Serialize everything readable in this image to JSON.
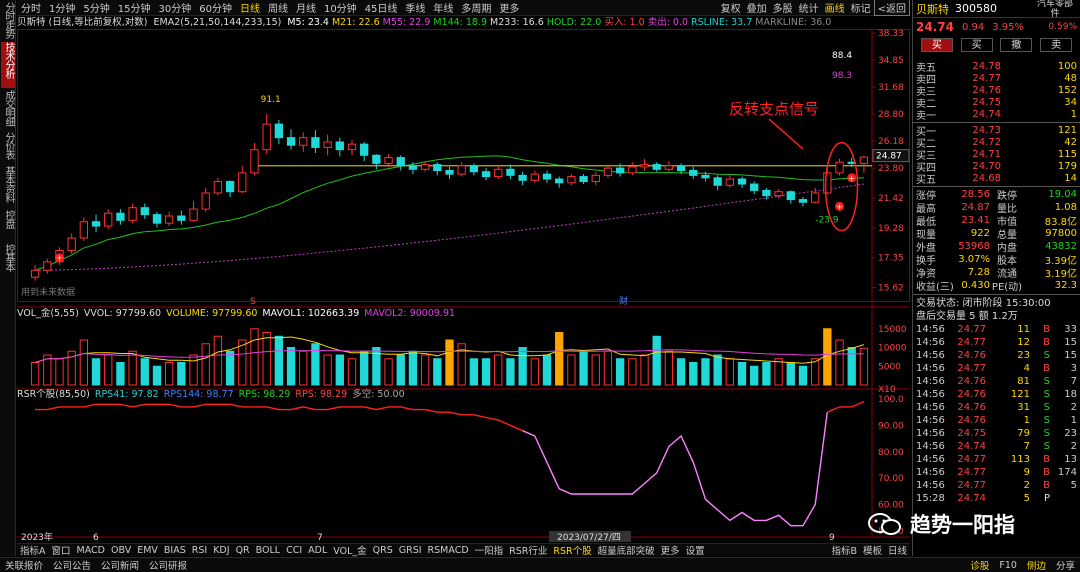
{
  "left_tabs": [
    "分时走势",
    "技术分析",
    "成交明细",
    "分价表",
    "基本资料",
    "控盘",
    "控基本"
  ],
  "periods": [
    "分时",
    "1分钟",
    "5分钟",
    "15分钟",
    "30分钟",
    "60分钟",
    "日线",
    "周线",
    "月线",
    "10分钟",
    "45日线",
    "季线",
    "年线",
    "多周期",
    "更多"
  ],
  "active_period": "日线",
  "tools": [
    "复权",
    "叠加",
    "多股",
    "统计",
    "画线",
    "标记",
    "<返回"
  ],
  "stock_header": {
    "name": "贝斯特",
    "info": "(日线,等比前复权,对数)"
  },
  "ema_label": "EMA2(5,21,50,144,233,15)",
  "ma_values": [
    {
      "text": "M5: 23.4",
      "color": "#ffffff"
    },
    {
      "text": "M21: 22.6",
      "color": "#ffd700"
    },
    {
      "text": "M55: 22.9",
      "color": "#e040e0"
    },
    {
      "text": "M144: 18.9",
      "color": "#20d020"
    },
    {
      "text": "M233: 16.6",
      "color": "#dddddd"
    },
    {
      "text": "HOLD: 22.0",
      "color": "#20d020"
    },
    {
      "text": "买入: 1.0",
      "color": "#ff4040"
    },
    {
      "text": "卖出: 0.0",
      "color": "#e040e0"
    },
    {
      "text": "RSLINE: 33.7",
      "color": "#20d0d0"
    },
    {
      "text": "MARKLINE: 36.0",
      "color": "#888888"
    }
  ],
  "price_axis": [
    "38.33",
    "34.85",
    "31.68",
    "28.80",
    "26.18",
    "23.80",
    "21.42",
    "19.28",
    "17.35",
    "15.62"
  ],
  "price_labels": {
    "high_label": "91.1",
    "low_label": "-23.9",
    "v1": "88.4",
    "v2": "98.3",
    "current": "24.87"
  },
  "annotation": "反转支点信号",
  "watermark": "用到未来数据",
  "chart_markers": {
    "s": "S",
    "cai": "财"
  },
  "vol_header": [
    {
      "text": "VOL_金(5,55)",
      "color": "#dddddd"
    },
    {
      "text": "VVOL: 97799.60",
      "color": "#dddddd"
    },
    {
      "text": "VOLUME: 97799.60",
      "color": "#ffd700"
    },
    {
      "text": "MAVOL1: 102663.39",
      "color": "#ffffff"
    },
    {
      "text": "MAVOL2: 90009.91",
      "color": "#e040e0"
    }
  ],
  "vol_axis": [
    "15000",
    "10000",
    "5000",
    "X10"
  ],
  "rsr_header": [
    {
      "text": "RSR个股(85,50)",
      "color": "#dddddd"
    },
    {
      "text": "RPS41: 97.82",
      "color": "#20d0d0"
    },
    {
      "text": "RPS144: 98.77",
      "color": "#4080ff"
    },
    {
      "text": "RPS: 98.29",
      "color": "#20d020"
    },
    {
      "text": "RPS: 98.29",
      "color": "#ff4040"
    },
    {
      "text": "多空: 50.00",
      "color": "#aaaaaa"
    }
  ],
  "rsr_axis": [
    "100.0",
    "90.00",
    "80.00",
    "70.00",
    "60.00",
    "50.00"
  ],
  "date_axis": [
    "2023年",
    "6",
    "7",
    "2023/07/27/四",
    "9"
  ],
  "bottom_tabs": [
    "指标A",
    "窗口",
    "MACD",
    "OBV",
    "EMV",
    "BIAS",
    "RSI",
    "KDJ",
    "QR",
    "BOLL",
    "CCI",
    "ADL",
    "VOL_金",
    "QRS",
    "GRSI",
    "RSMACD",
    "一阳指",
    "RSR行业",
    "RSR个股",
    "超量底部突破",
    "更多",
    "设置"
  ],
  "active_bottom": "RSR个股",
  "bottom_right": [
    "指标B",
    "模板",
    "日线"
  ],
  "statusbar": [
    "关联报价",
    "公司公告",
    "公司新闻",
    "公司研报"
  ],
  "statusbar_right": [
    "诊股",
    "F10",
    "侧边",
    "分享"
  ],
  "right_panel": {
    "name": "贝斯特",
    "code": "300580",
    "industry": "汽车零部件",
    "price": "24.74",
    "change": "0.94",
    "pct": "3.95%",
    "small_pct": "0.59%",
    "buttons": [
      "买",
      "买",
      "撤",
      "卖"
    ],
    "sells": [
      [
        "卖五",
        "24.78",
        "100"
      ],
      [
        "卖四",
        "24.77",
        "48"
      ],
      [
        "卖三",
        "24.76",
        "152"
      ],
      [
        "卖二",
        "24.75",
        "34"
      ],
      [
        "卖一",
        "24.74",
        "1"
      ]
    ],
    "buys": [
      [
        "买一",
        "24.73",
        "121"
      ],
      [
        "买二",
        "24.72",
        "42"
      ],
      [
        "买三",
        "24.71",
        "115"
      ],
      [
        "买四",
        "24.70",
        "179"
      ],
      [
        "买五",
        "24.68",
        "14"
      ]
    ],
    "stats": [
      [
        "涨停",
        "28.56",
        "跌停",
        "19.04"
      ],
      [
        "最高",
        "24.87",
        "量比",
        "1.08"
      ],
      [
        "最低",
        "23.41",
        "市值",
        "83.8亿"
      ],
      [
        "现量",
        "922",
        "总量",
        "97800"
      ],
      [
        "外盘",
        "53968",
        "内盘",
        "43832"
      ],
      [
        "换手",
        "3.07%",
        "股本",
        "3.39亿"
      ],
      [
        "净资",
        "7.28",
        "流通",
        "3.19亿"
      ],
      [
        "收益(三)",
        "0.430",
        "PE(动)",
        "32.3"
      ]
    ],
    "trade_status": "交易状态: 闭市阶段 15:30:00",
    "after_hours": "盘后交易量 5 额 1.2万",
    "trades": [
      [
        "14:56",
        "24.77",
        "11",
        "B",
        "33"
      ],
      [
        "14:56",
        "24.77",
        "12",
        "B",
        "15"
      ],
      [
        "14:56",
        "24.76",
        "23",
        "S",
        "15"
      ],
      [
        "14:56",
        "24.77",
        "4",
        "B",
        "3"
      ],
      [
        "14:56",
        "24.76",
        "81",
        "S",
        "7"
      ],
      [
        "14:56",
        "24.76",
        "121",
        "S",
        "18"
      ],
      [
        "14:56",
        "24.76",
        "31",
        "S",
        "2"
      ],
      [
        "14:56",
        "24.76",
        "1",
        "S",
        "1"
      ],
      [
        "14:56",
        "24.75",
        "79",
        "S",
        "23"
      ],
      [
        "14:56",
        "24.74",
        "7",
        "S",
        "2"
      ],
      [
        "14:56",
        "24.77",
        "113",
        "B",
        "13"
      ],
      [
        "14:56",
        "24.77",
        "9",
        "B",
        "174"
      ],
      [
        "14:56",
        "24.77",
        "2",
        "B",
        "5"
      ],
      [
        "15:28",
        "24.74",
        "5",
        "P",
        ""
      ]
    ]
  },
  "overlay_text": "趋势一阳指",
  "chart_data": {
    "type": "candlestick",
    "y_axis_ticks": [
      38.33,
      34.85,
      31.68,
      28.8,
      26.18,
      23.8,
      21.42,
      19.28,
      17.35,
      15.62
    ],
    "ylim": [
      15.0,
      38.33
    ],
    "log_scale": true,
    "candles": [
      [
        16.2,
        16.6,
        16.9,
        16.0
      ],
      [
        16.6,
        17.1,
        17.3,
        16.4
      ],
      [
        17.1,
        17.8,
        18.0,
        16.9
      ],
      [
        17.8,
        18.6,
        18.9,
        17.6
      ],
      [
        18.6,
        19.7,
        20.0,
        18.4
      ],
      [
        19.7,
        19.4,
        20.2,
        19.0
      ],
      [
        19.4,
        20.3,
        20.6,
        19.2
      ],
      [
        20.3,
        19.8,
        20.6,
        19.5
      ],
      [
        19.8,
        20.7,
        21.0,
        19.6
      ],
      [
        20.7,
        20.2,
        21.0,
        19.9
      ],
      [
        20.2,
        19.6,
        20.4,
        19.3
      ],
      [
        19.6,
        20.1,
        20.4,
        19.4
      ],
      [
        20.1,
        19.8,
        20.5,
        19.5
      ],
      [
        19.8,
        20.6,
        21.2,
        19.7
      ],
      [
        20.6,
        21.8,
        22.2,
        20.4
      ],
      [
        21.8,
        22.7,
        23.0,
        21.6
      ],
      [
        22.7,
        21.9,
        22.8,
        21.5
      ],
      [
        21.9,
        23.4,
        24.0,
        21.8
      ],
      [
        23.4,
        25.4,
        26.0,
        23.2
      ],
      [
        25.4,
        27.8,
        28.8,
        25.0
      ],
      [
        27.8,
        26.5,
        28.2,
        25.9
      ],
      [
        26.5,
        25.8,
        27.3,
        25.4
      ],
      [
        25.8,
        26.5,
        27.0,
        25.2
      ],
      [
        26.5,
        25.6,
        27.2,
        25.1
      ],
      [
        25.6,
        26.1,
        26.8,
        24.9
      ],
      [
        26.1,
        25.4,
        26.5,
        24.8
      ],
      [
        25.4,
        25.9,
        26.3,
        24.9
      ],
      [
        25.9,
        24.9,
        26.1,
        24.4
      ],
      [
        24.9,
        24.2,
        25.0,
        23.7
      ],
      [
        24.2,
        24.7,
        25.0,
        23.9
      ],
      [
        24.7,
        24.0,
        24.9,
        23.6
      ],
      [
        24.0,
        23.7,
        24.3,
        23.3
      ],
      [
        23.7,
        24.1,
        24.4,
        23.5
      ],
      [
        24.1,
        23.6,
        24.3,
        23.2
      ],
      [
        23.6,
        23.3,
        23.9,
        22.9
      ],
      [
        23.3,
        24.0,
        24.3,
        23.1
      ],
      [
        24.0,
        23.5,
        24.2,
        23.2
      ],
      [
        23.5,
        23.1,
        23.8,
        22.8
      ],
      [
        23.1,
        23.7,
        24.0,
        22.9
      ],
      [
        23.7,
        23.2,
        24.1,
        22.9
      ],
      [
        23.2,
        22.8,
        23.5,
        22.4
      ],
      [
        22.8,
        23.3,
        23.6,
        22.6
      ],
      [
        23.3,
        22.9,
        23.6,
        22.6
      ],
      [
        22.9,
        22.6,
        23.1,
        22.2
      ],
      [
        22.6,
        23.1,
        23.3,
        22.4
      ],
      [
        23.1,
        22.7,
        23.3,
        22.5
      ],
      [
        22.7,
        23.2,
        23.5,
        22.4
      ],
      [
        23.2,
        23.8,
        24.1,
        23.0
      ],
      [
        23.8,
        23.4,
        24.2,
        23.1
      ],
      [
        23.4,
        23.9,
        24.3,
        23.2
      ],
      [
        23.9,
        24.1,
        24.6,
        23.6
      ],
      [
        24.1,
        23.7,
        24.3,
        23.5
      ],
      [
        23.7,
        24.0,
        24.4,
        23.5
      ],
      [
        24.0,
        23.6,
        24.2,
        23.3
      ],
      [
        23.6,
        23.2,
        23.9,
        22.9
      ],
      [
        23.2,
        23.0,
        23.5,
        22.7
      ],
      [
        23.0,
        22.4,
        23.2,
        22.0
      ],
      [
        22.4,
        22.9,
        23.2,
        22.2
      ],
      [
        22.9,
        22.5,
        23.1,
        22.2
      ],
      [
        22.5,
        22.0,
        22.7,
        21.7
      ],
      [
        22.0,
        21.6,
        22.2,
        21.3
      ],
      [
        21.6,
        21.9,
        22.1,
        21.4
      ],
      [
        21.9,
        21.3,
        22.0,
        21.0
      ],
      [
        21.3,
        21.1,
        21.5,
        20.8
      ],
      [
        21.1,
        21.8,
        22.2,
        21.0
      ],
      [
        21.8,
        23.4,
        23.8,
        21.7
      ],
      [
        23.4,
        24.3,
        24.6,
        23.2
      ],
      [
        24.3,
        24.2,
        24.7,
        23.9
      ],
      [
        24.2,
        24.74,
        24.87,
        23.41
      ]
    ],
    "volume": [
      6000,
      8000,
      7000,
      9000,
      12000,
      7000,
      8000,
      6000,
      9000,
      7000,
      5000,
      6000,
      6000,
      8000,
      11000,
      13000,
      9000,
      12000,
      15000,
      14000,
      13000,
      10000,
      9000,
      11000,
      8000,
      8000,
      7000,
      9000,
      10000,
      7000,
      8000,
      9000,
      8000,
      7000,
      12000,
      11000,
      7000,
      7000,
      8000,
      7000,
      10000,
      7000,
      8000,
      14000,
      8000,
      9000,
      8000,
      9000,
      7000,
      7000,
      8000,
      13000,
      9000,
      7000,
      6000,
      7000,
      8000,
      7000,
      6000,
      5000,
      6000,
      7000,
      6000,
      5000,
      7000,
      15000,
      12000,
      10000,
      9800
    ],
    "volume_highlight": [
      34,
      43,
      65
    ],
    "rsr": [
      96,
      96,
      97,
      97,
      97,
      98,
      98,
      98,
      97,
      98,
      98,
      98,
      97,
      97,
      98,
      98,
      98,
      97,
      97,
      97,
      96,
      96,
      97,
      96,
      96,
      97,
      97,
      97,
      96,
      97,
      97,
      96,
      96,
      95,
      95,
      94,
      94,
      93,
      92,
      90,
      88,
      86,
      76,
      66,
      64,
      64,
      64,
      64,
      64,
      64,
      68,
      72,
      82,
      86,
      76,
      62,
      58,
      54,
      57,
      54,
      54,
      56,
      52,
      52,
      60,
      95,
      97,
      97,
      99
    ]
  }
}
